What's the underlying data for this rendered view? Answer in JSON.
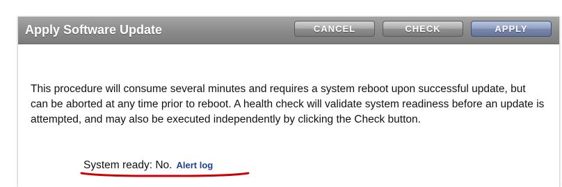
{
  "dialog": {
    "title": "Apply Software Update",
    "buttons": {
      "cancel": "CANCEL",
      "check": "CHECK",
      "apply": "APPLY"
    },
    "description": "This procedure will consume several minutes and requires a system reboot upon successful update, but can be aborted at any time prior to reboot. A health check will validate system readiness before an update is attempted, and may also be executed independently by clicking the Check button.",
    "status": {
      "label": "System ready: No.",
      "link": "Alert log"
    }
  },
  "colors": {
    "titlebar": "#8d8d8d",
    "apply_button": "#7888ad",
    "link": "#1f3f99",
    "annotation_underline": "#cc0000"
  }
}
